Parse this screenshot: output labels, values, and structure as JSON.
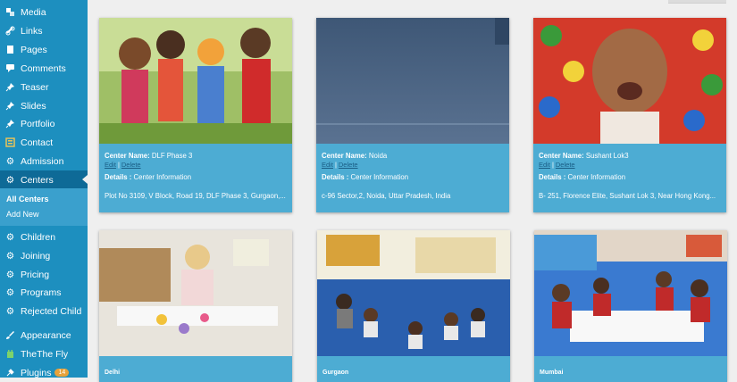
{
  "sidebar": {
    "items": [
      {
        "label": "Media",
        "icon": "media-icon"
      },
      {
        "label": "Links",
        "icon": "link-icon"
      },
      {
        "label": "Pages",
        "icon": "pages-icon"
      },
      {
        "label": "Comments",
        "icon": "comments-icon"
      },
      {
        "label": "Teaser",
        "icon": "pin-icon"
      },
      {
        "label": "Slides",
        "icon": "pin-icon"
      },
      {
        "label": "Portfolio",
        "icon": "pin-icon"
      },
      {
        "label": "Contact",
        "icon": "contact-icon"
      },
      {
        "label": "Admission",
        "icon": "gear-icon"
      },
      {
        "label": "Centers",
        "icon": "gear-icon"
      },
      {
        "label": "Children",
        "icon": "gear-icon"
      },
      {
        "label": "Joining",
        "icon": "gear-icon"
      },
      {
        "label": "Pricing",
        "icon": "gear-icon"
      },
      {
        "label": "Programs",
        "icon": "gear-icon"
      },
      {
        "label": "Rejected Child",
        "icon": "gear-icon"
      },
      {
        "label": "Appearance",
        "icon": "brush-icon"
      },
      {
        "label": "TheThe Fly",
        "icon": "plugin-icon"
      },
      {
        "label": "Plugins",
        "icon": "plugin-icon",
        "badge": "14"
      }
    ],
    "submenu": {
      "all_centers": "All Centers",
      "add_new": "Add New"
    }
  },
  "labels": {
    "center_name": "Center Name:",
    "edit": "Edit",
    "separator": "|",
    "delete": "Delete",
    "details": "Details :"
  },
  "cards": [
    {
      "name": "DLF Phase 3",
      "details": "Center Information",
      "address": "Plot No 3109, V Block, Road 19, DLF Phase 3, Gurgaon,..."
    },
    {
      "name": "Noida",
      "details": "Center Information",
      "address": "c-96 Sector,2, Noida, Uttar Pradesh, India"
    },
    {
      "name": "Sushant Lok3",
      "details": "Center Information",
      "address": "B- 251, Florence Elite, Sushant Lok 3, Near Hong Kong..."
    },
    {
      "title": "Delhi"
    },
    {
      "title": "Gurgaon"
    },
    {
      "title": "Mumbai"
    }
  ],
  "colors": {
    "sidebar": "#1d8fbf",
    "active_menu": "#0e6a97",
    "card": "#4dacd3",
    "link": "#1a5e86"
  }
}
